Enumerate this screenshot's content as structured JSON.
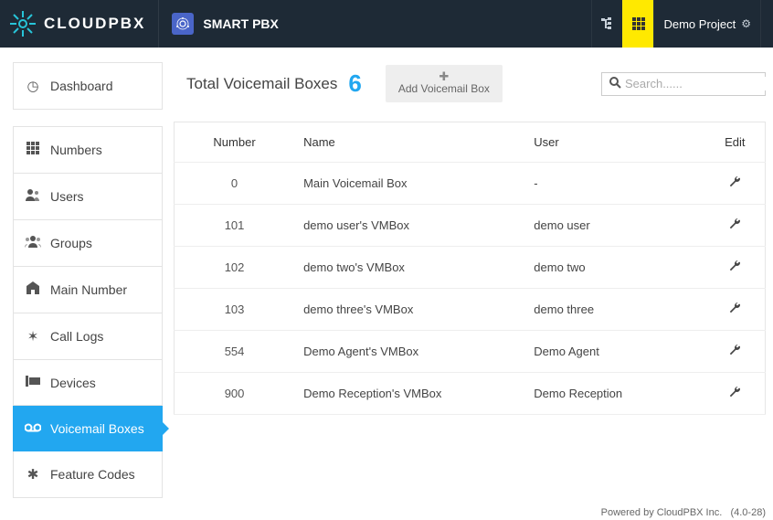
{
  "brand": {
    "name": "CLOUDPBX"
  },
  "app": {
    "name": "SMART PBX"
  },
  "project": {
    "label": "Demo Project"
  },
  "sidebar": {
    "items": [
      {
        "label": "Dashboard",
        "icon": "dashboard-icon"
      },
      {
        "label": "Numbers",
        "icon": "numbers-icon"
      },
      {
        "label": "Users",
        "icon": "users-icon"
      },
      {
        "label": "Groups",
        "icon": "groups-icon"
      },
      {
        "label": "Main Number",
        "icon": "main-number-icon"
      },
      {
        "label": "Call Logs",
        "icon": "call-logs-icon"
      },
      {
        "label": "Devices",
        "icon": "devices-icon"
      },
      {
        "label": "Voicemail Boxes",
        "icon": "voicemail-icon",
        "active": true
      },
      {
        "label": "Feature Codes",
        "icon": "feature-codes-icon"
      }
    ]
  },
  "header": {
    "total_label": "Total Voicemail Boxes",
    "total_count": "6",
    "add_label": "Add Voicemail Box",
    "search_placeholder": "Search......"
  },
  "table": {
    "columns": [
      "Number",
      "Name",
      "User",
      "Edit"
    ],
    "rows": [
      {
        "number": "0",
        "name": "Main Voicemail Box",
        "user": "-"
      },
      {
        "number": "101",
        "name": "demo user's VMBox",
        "user": "demo user"
      },
      {
        "number": "102",
        "name": "demo two's VMBox",
        "user": "demo two"
      },
      {
        "number": "103",
        "name": "demo three's VMBox",
        "user": "demo three"
      },
      {
        "number": "554",
        "name": "Demo Agent's VMBox",
        "user": "Demo Agent"
      },
      {
        "number": "900",
        "name": "Demo Reception's VMBox",
        "user": "Demo Reception"
      }
    ]
  },
  "footer": {
    "text": "Powered by CloudPBX Inc.",
    "version": "(4.0-28)"
  }
}
